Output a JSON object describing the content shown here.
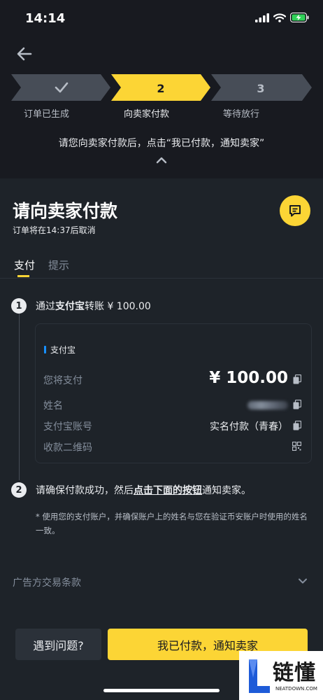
{
  "status_bar": {
    "time": "14:14"
  },
  "steps": [
    {
      "number": "✓",
      "label": "订单已生成",
      "state": "done"
    },
    {
      "number": "2",
      "label": "向卖家付款",
      "state": "active"
    },
    {
      "number": "3",
      "label": "等待放行",
      "state": "pending"
    }
  ],
  "instruction": "请您向卖家付款后，点击“我已付款，通知卖家”",
  "title": "请向卖家付款",
  "subtitle": "订单将在14:37后取消",
  "tabs": {
    "pay": "支付",
    "tips": "提示"
  },
  "step1": {
    "num": "1",
    "prefix": "通过",
    "method": "支付宝",
    "suffix": "转账 ¥ 100.00"
  },
  "card": {
    "tag": "支付宝",
    "rows": {
      "amount_label": "您将支付",
      "amount_value": "¥ 100.00",
      "name_label": "姓名",
      "account_label": "支付宝账号",
      "account_value": "实名付款（青春）",
      "qr_label": "收款二维码"
    }
  },
  "step2": {
    "num": "2",
    "prefix": "请确保付款成功，然后",
    "link": "点击下面的按钮",
    "suffix": "通知卖家。"
  },
  "note": "* 使用您的支付账户，并确保账户上的姓名与您在验证币安账户时使用的姓名一致。",
  "terms": "广告方交易条款",
  "buttons": {
    "problem": "遇到问题?",
    "paid": "我已付款，通知卖家"
  },
  "watermark": {
    "text": "链懂",
    "sub": "NEATDOWN.COM"
  },
  "colors": {
    "accent": "#fcd535",
    "background": "#1e2329",
    "header_bg": "#181a20",
    "alipay_blue": "#1890ff"
  }
}
